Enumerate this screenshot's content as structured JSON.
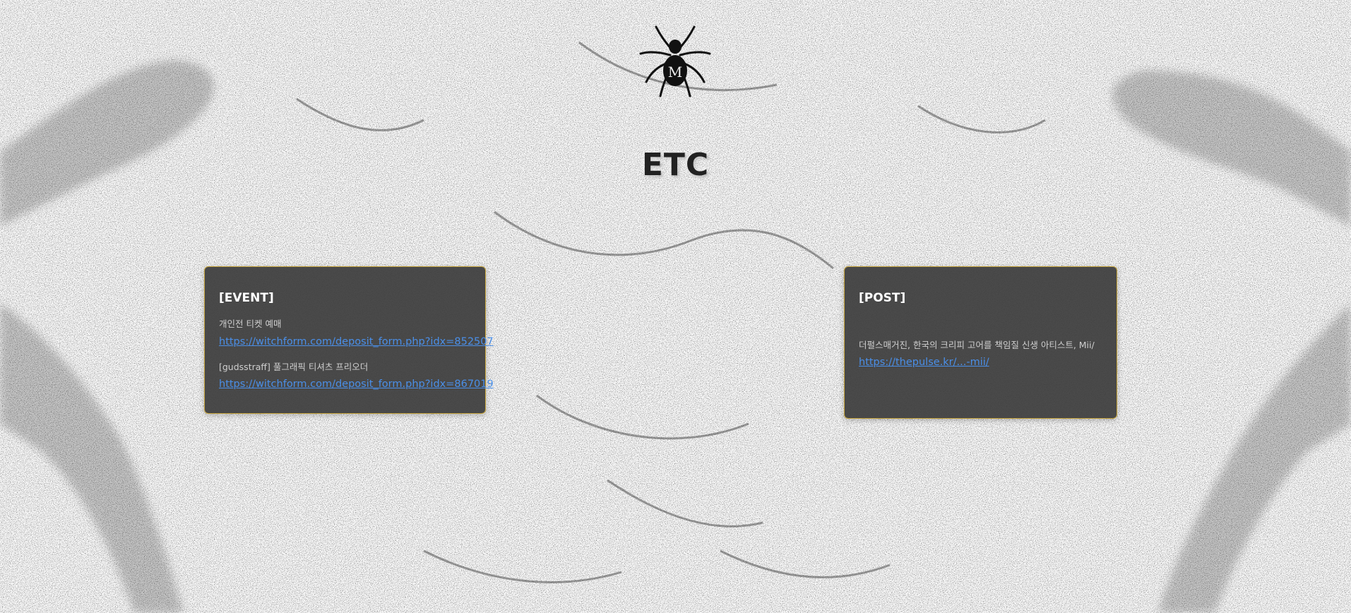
{
  "page": {
    "title": "ETC"
  },
  "event_card": {
    "heading": "[EVENT]",
    "line1": "개인전 티켓 예매",
    "link1": "https://witchform.com/deposit_form.php?idx=852507",
    "line2": "[gudsstraff] 풀그래픽 티셔츠 프리오더",
    "link2": "https://witchform.com/deposit_form.php?idx=867019"
  },
  "post_card": {
    "heading": "[POST]",
    "line1": "더펄스매거진, 한국의 크리피 고어를 책임질 신생 아티스트, Mii/",
    "link1": "https://thepulse.kr/...-mii/"
  },
  "icons": {
    "logo": "spider-logo-icon"
  },
  "colors": {
    "card_bg": "#3c3c3c",
    "card_border": "#c5a33b",
    "link": "#4a8fe8",
    "heading": "#ffffff"
  }
}
